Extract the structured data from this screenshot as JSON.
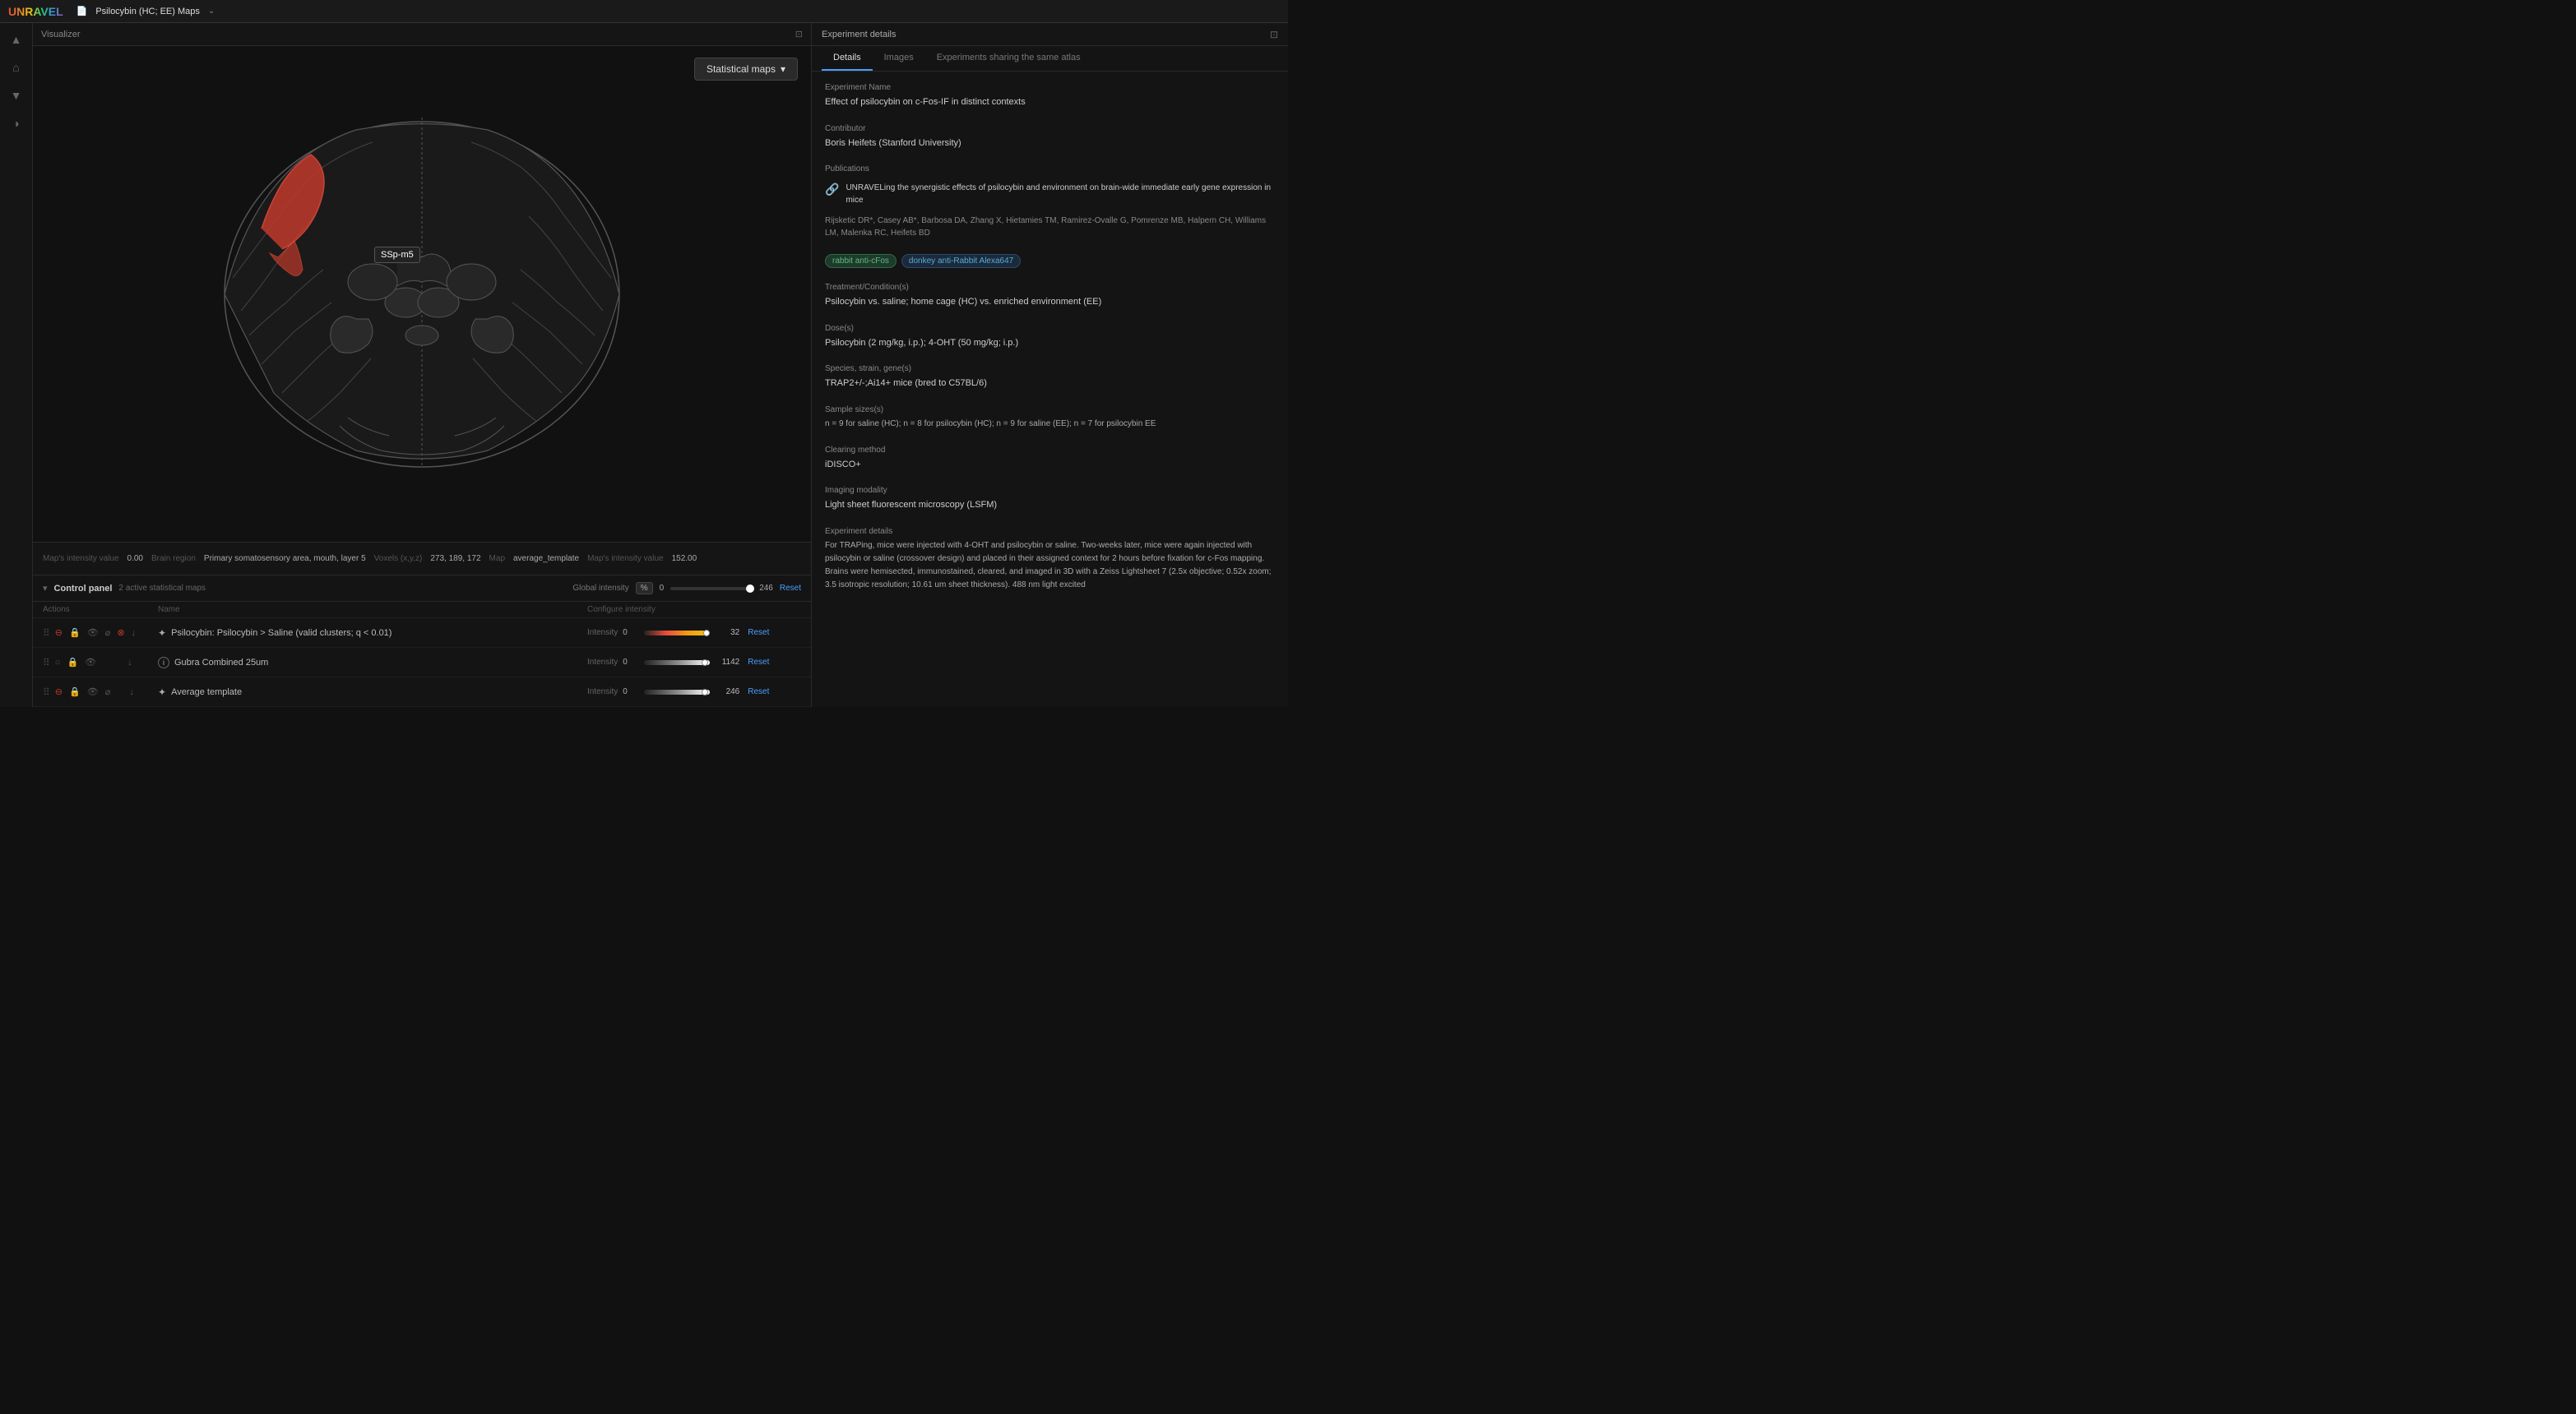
{
  "topbar": {
    "logo": "UNRAVEL",
    "doc_icon": "📄",
    "title": "Psilocybin (HC; EE) Maps",
    "chevron": "⌄"
  },
  "visualizer": {
    "label": "Visualizer",
    "close_icon": "⊡"
  },
  "stat_maps_button": "Statistical maps",
  "brain_tooltip": "SSp-m5",
  "status_bar": {
    "brain_region_label": "Brain region",
    "brain_region_value": "Primary somatosensory area, mouth, layer 5",
    "voxels_label": "Voxels (x,y,z)",
    "voxels_value": "273, 189, 172",
    "map_label": "Map",
    "map_value": "average_template",
    "map_intensity_label": "Map's intensity value",
    "map_intensity_value": "152.00",
    "map2_intensity_label": "Map's intensity value",
    "map2_intensity_value": "0.00"
  },
  "control_panel": {
    "title": "Control panel",
    "subtitle": "2 active statistical maps",
    "global_intensity_label": "Global intensity",
    "pct_badge": "%",
    "global_min": "0",
    "global_max": "246",
    "reset_label": "Reset",
    "columns": {
      "actions": "Actions",
      "name": "Name",
      "configure": "Configure intensity"
    },
    "rows": [
      {
        "id": "row1",
        "name": "Psilocybin: Psilocybin > Saline (valid clusters; q < 0.01)",
        "type": "star",
        "intensity_label": "Intensity",
        "intensity_min": "0",
        "intensity_max": "32",
        "reset": "Reset",
        "gradient": "psilocybin"
      },
      {
        "id": "row2",
        "name": "Gubra Combined 25um",
        "type": "info",
        "intensity_label": "Intensity",
        "intensity_min": "0",
        "intensity_max": "1142",
        "reset": "Reset",
        "gradient": "gray"
      },
      {
        "id": "row3",
        "name": "Average template",
        "type": "star",
        "intensity_label": "Intensity",
        "intensity_min": "0",
        "intensity_max": "246",
        "reset": "Reset",
        "gradient": "gray"
      }
    ]
  },
  "right_panel": {
    "title": "Experiment details",
    "close_icon": "⊡",
    "tabs": [
      "Details",
      "Images",
      "Experiments sharing the same atlas"
    ],
    "active_tab": "Details",
    "experiment_name_label": "Experiment Name",
    "experiment_name_value": "Effect of psilocybin on c-Fos-IF in distinct contexts",
    "contributor_label": "Contributor",
    "contributor_value": "Boris Heifets (Stanford University)",
    "publications_label": "Publications",
    "pub_icon": "🔗",
    "pub_title": "UNRAVELing the synergistic effects of psilocybin and environment on brain-wide immediate early gene expression in mice",
    "pub_authors": "Rijsketic DR*, Casey AB*, Barbosa DA, Zhang X, Hietamies TM, Ramirez-Ovalle G, Pomrenze MB, Halpern CH, Williams LM, Malenka RC, Heifets BD",
    "tags": [
      "rabbit anti-cFos",
      "donkey anti-Rabbit Alexa647"
    ],
    "treatment_label": "Treatment/Condition(s)",
    "treatment_value": "Psilocybin vs. saline; home cage (HC) vs. enriched environment (EE)",
    "dose_label": "Dose(s)",
    "dose_value": "Psilocybin (2 mg/kg, i.p.); 4-OHT (50 mg/kg; i.p.)",
    "species_label": "Species, strain, gene(s)",
    "species_value": "TRAP2+/-;Ai14+ mice (bred to C57BL/6)",
    "sample_label": "Sample sizes(s)",
    "sample_value": "n = 9 for saline (HC); n = 8 for psilocybin (HC); n = 9 for saline (EE); n = 7 for psilocybin EE",
    "clearing_label": "Clearing method",
    "clearing_value": "iDISCO+",
    "imaging_label": "Imaging modality",
    "imaging_value": "Light sheet fluorescent microscopy (LSFM)",
    "exp_details_label": "Experiment details",
    "exp_details_value": "For TRAPing, mice were injected with 4-OHT and psilocybin or saline. Two-weeks later, mice were again injected with psilocybin or saline (crossover design) and placed in their assigned context for 2 hours before fixation for c-Fos mapping. Brains were hemisected, immunostained, cleared, and imaged in 3D with a Zeiss Lightsheet 7 (2.5x objective; 0.52x zoom; 3.5 isotropic resolution; 10.61 um sheet thickness). 488 nm light excited"
  }
}
